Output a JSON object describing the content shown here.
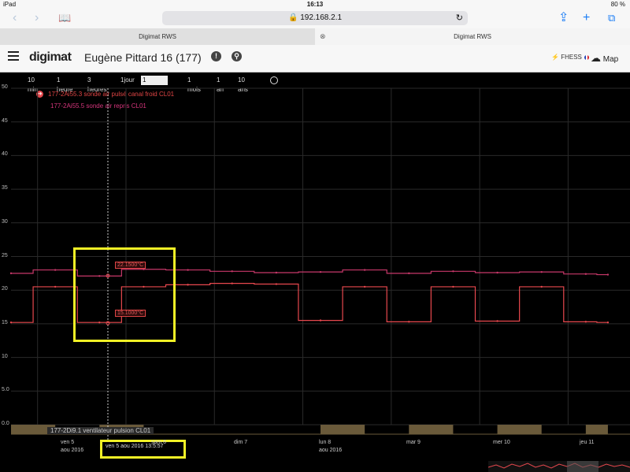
{
  "status": {
    "device": "iPad",
    "time": "16:13",
    "battery": "80 %"
  },
  "browser": {
    "url": "192.168.2.1",
    "tabs": [
      "Digimat RWS",
      "Digimat RWS"
    ]
  },
  "app": {
    "logo": "digimat",
    "site": "Eugène Pittard 16 (177)",
    "user": "FHESS",
    "map_label": "Map"
  },
  "ranges": [
    "10 min",
    "1 heure",
    "3 heures",
    "1jour",
    "1 semaine",
    "1 mois",
    "1 an",
    "10 ans"
  ],
  "active_range": "1 semaine",
  "legend": {
    "series1": "177-2Ai55.3  sonde air pulsé canal froid CL01",
    "series2": "177-2Ai55.5  sonde air repris CL01"
  },
  "digital_label": "177-2Di9.1  ventilateur pulsion CL01",
  "tooltips": {
    "upper": "22.1500°C",
    "lower": "15.1000°C"
  },
  "cursor_label": "ven 5 aou 2016 13:5:57",
  "colors": {
    "series1": "#e8484e",
    "series2": "#c8386a",
    "highlight": "#f2f226"
  },
  "chart_data": {
    "type": "line",
    "ylim": [
      0,
      50
    ],
    "yticks": [
      "50",
      "45",
      "40",
      "35",
      "30",
      "25",
      "20",
      "15",
      "10",
      "5.0",
      "0.0"
    ],
    "xtick_labels": [
      {
        "line1": "ven 5",
        "line2": "aou 2016"
      },
      {
        "line1": "sam 6",
        "line2": ""
      },
      {
        "line1": "dim 7",
        "line2": ""
      },
      {
        "line1": "lun 8",
        "line2": "aou 2016"
      },
      {
        "line1": "mar 9",
        "line2": ""
      },
      {
        "line1": "mer 10",
        "line2": ""
      },
      {
        "line1": "jeu 11",
        "line2": ""
      }
    ],
    "x": [
      0,
      0.5,
      1.0,
      1.5,
      2.0,
      2.5,
      3.0,
      3.5,
      4.0,
      4.5,
      5.0,
      5.5,
      6.0,
      6.5,
      6.75
    ],
    "series": [
      {
        "name": "177-2Ai55.3  sonde air pulsé canal froid CL01",
        "values": [
          15.2,
          20.5,
          15.2,
          20.5,
          20.8,
          21.0,
          20.9,
          15.5,
          20.5,
          15.3,
          20.5,
          15.4,
          20.5,
          15.3,
          15.2
        ]
      },
      {
        "name": "177-2Ai55.5  sonde air repris CL01",
        "values": [
          22.5,
          23.0,
          22.1,
          23.1,
          23.0,
          22.8,
          22.6,
          22.7,
          23.0,
          22.5,
          22.8,
          22.6,
          22.7,
          22.4,
          22.3
        ]
      }
    ],
    "digital_on_periods": [
      [
        0,
        0.5
      ],
      [
        1.0,
        1.5
      ],
      [
        3.5,
        4.0
      ],
      [
        4.5,
        5.0
      ],
      [
        5.5,
        6.0
      ],
      [
        6.5,
        6.75
      ]
    ]
  }
}
